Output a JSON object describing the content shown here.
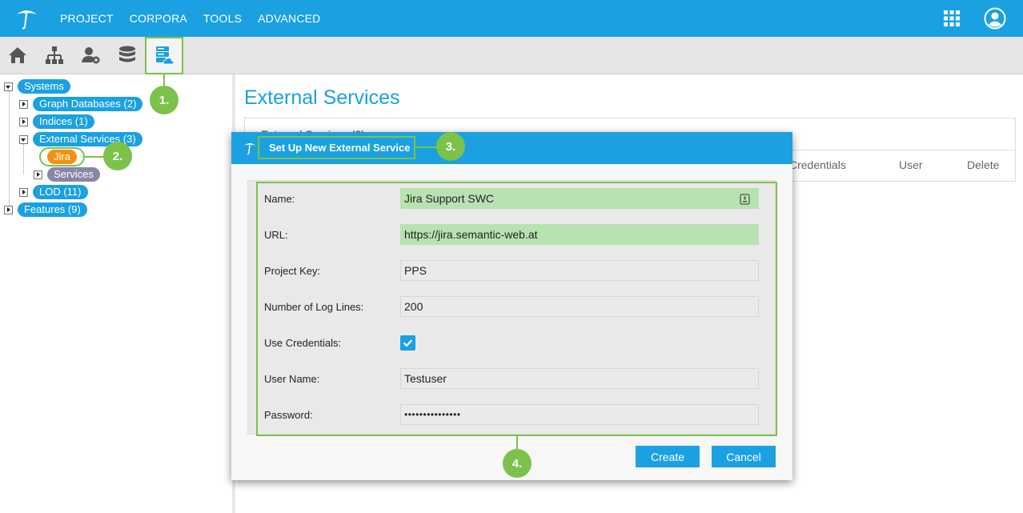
{
  "topnav": {
    "items": [
      "PROJECT",
      "CORPORA",
      "TOOLS",
      "ADVANCED"
    ],
    "icons": [
      "umbrella-logo-icon",
      "apps-grid-icon",
      "user-account-icon"
    ]
  },
  "toolbar": {
    "icons": [
      "home-icon",
      "hierarchy-icon",
      "user-settings-icon",
      "database-icon",
      "server-cloud-icon"
    ]
  },
  "tree": {
    "systems": "Systems",
    "graph_databases": "Graph Databases (2)",
    "indices": "Indices (1)",
    "external_services": "External Services (3)",
    "jira": "Jira",
    "services": "Services",
    "lod": "LOD (11)",
    "features": "Features (9)"
  },
  "main": {
    "title": "External Services",
    "panel_head": "External Services (3)",
    "columns": [
      "Credentials",
      "User",
      "Delete"
    ]
  },
  "dialog": {
    "title": "Set Up New External Service",
    "fields": {
      "name_label": "Name:",
      "name_value": "Jira Support SWC",
      "url_label": "URL:",
      "url_value": "https://jira.semantic-web.at",
      "project_key_label": "Project Key:",
      "project_key_value": "PPS",
      "log_lines_label": "Number of Log Lines:",
      "log_lines_value": "200",
      "use_credentials_label": "Use Credentials:",
      "use_credentials_checked": true,
      "username_label": "User Name:",
      "username_value": "Testuser",
      "password_label": "Password:",
      "password_value": "•••••••••••••••"
    },
    "create_label": "Create",
    "cancel_label": "Cancel"
  },
  "callouts": [
    "1.",
    "2.",
    "3.",
    "4."
  ],
  "colors": {
    "brand": "#1ba1e2",
    "highlight": "#7cc24a",
    "jira": "#f29111",
    "services": "#8a86a8",
    "valid_field": "#b7e3b0"
  }
}
